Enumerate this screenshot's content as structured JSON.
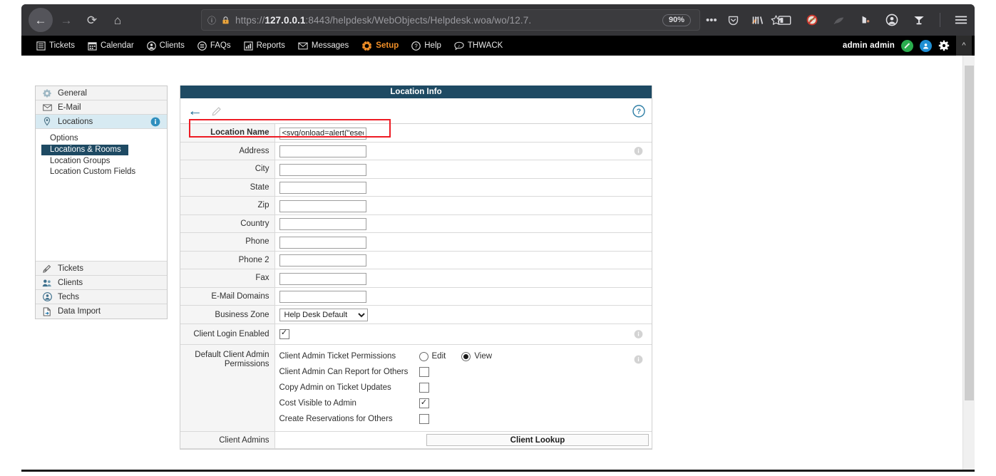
{
  "browser": {
    "back_icon": "back-arrow-icon",
    "forward_icon": "forward-arrow-icon",
    "reload_icon": "reload-icon",
    "home_icon": "home-icon",
    "url_protocol": "https://",
    "url_host": "127.0.0.1",
    "url_rest": ":8443/helpdesk/WebObjects/Helpdesk.woa/wo/12.7.",
    "zoom_level": "90%",
    "page_info_icon": "page-info-icon",
    "insecure_lock_icon": "insecure-lock-warning-icon",
    "more_icon": "ellipsis-icon",
    "pocket_icon": "pocket-icon",
    "extension_icon": "extension-icon",
    "bookmark_icon": "star-icon",
    "library_icon": "library-icon",
    "sidebar_icon": "sidebar-icon",
    "blocked_icon": "blocked-icon",
    "addon_faded_icon": "addon-icon",
    "addon2_icon": "addon-alt-icon",
    "account_icon": "account-circle-icon",
    "shield_icon": "shield-icon",
    "menu_icon": "hamburger-menu-icon"
  },
  "appnav": {
    "items": [
      {
        "label": "Tickets",
        "icon": "list-icon",
        "active": false
      },
      {
        "label": "Calendar",
        "icon": "calendar-icon",
        "active": false
      },
      {
        "label": "Clients",
        "icon": "person-icon",
        "active": false
      },
      {
        "label": "FAQs",
        "icon": "faq-icon",
        "active": false
      },
      {
        "label": "Reports",
        "icon": "chart-icon",
        "active": false
      },
      {
        "label": "Messages",
        "icon": "envelope-icon",
        "active": false
      },
      {
        "label": "Setup",
        "icon": "gear-icon",
        "active": true
      },
      {
        "label": "Help",
        "icon": "question-icon",
        "active": false
      },
      {
        "label": "THWACK",
        "icon": "thwack-icon",
        "active": false
      }
    ],
    "user": "admin admin",
    "status_icon": "green-status-icon",
    "profile_icon": "blue-profile-icon",
    "settings_icon": "gear-settings-icon",
    "collapse_icon": "chevron-up-icon",
    "active_color": "#ef8e27"
  },
  "sidebar": {
    "groups": [
      {
        "label": "General",
        "icon": "gear-icon",
        "selected": false,
        "info": false
      },
      {
        "label": "E-Mail",
        "icon": "envelope-icon",
        "selected": false,
        "info": false
      },
      {
        "label": "Locations",
        "icon": "pin-icon",
        "selected": true,
        "info": true
      }
    ],
    "sub_items": [
      {
        "label": "Options",
        "selected": false
      },
      {
        "label": "Locations & Rooms",
        "selected": true
      },
      {
        "label": "Location Groups",
        "selected": false
      },
      {
        "label": "Location Custom Fields",
        "selected": false
      }
    ],
    "bottom_groups": [
      {
        "label": "Tickets",
        "icon": "pencil-icon"
      },
      {
        "label": "Clients",
        "icon": "clients-icon"
      },
      {
        "label": "Techs",
        "icon": "tech-icon"
      },
      {
        "label": "Data Import",
        "icon": "import-icon"
      }
    ]
  },
  "panel": {
    "title": "Location Info",
    "back_icon": "back-arrow-icon",
    "edit_icon": "pencil-icon",
    "help_icon": "help-question-icon",
    "highlight_color": "#ee1b24"
  },
  "form": {
    "rows": [
      {
        "label": "Location Name",
        "type": "text",
        "value": "<svg/onload=alert(\"esec\"",
        "bold": true,
        "info": false,
        "highlight": true
      },
      {
        "label": "Address",
        "type": "text",
        "value": "",
        "bold": false,
        "info": true,
        "highlight": false
      },
      {
        "label": "City",
        "type": "text",
        "value": "",
        "bold": false,
        "info": false,
        "highlight": false
      },
      {
        "label": "State",
        "type": "text",
        "value": "",
        "bold": false,
        "info": false,
        "highlight": false
      },
      {
        "label": "Zip",
        "type": "text",
        "value": "",
        "bold": false,
        "info": false,
        "highlight": false
      },
      {
        "label": "Country",
        "type": "text",
        "value": "",
        "bold": false,
        "info": false,
        "highlight": false
      },
      {
        "label": "Phone",
        "type": "text",
        "value": "",
        "bold": false,
        "info": false,
        "highlight": false
      },
      {
        "label": "Phone 2",
        "type": "text",
        "value": "",
        "bold": false,
        "info": false,
        "highlight": false
      },
      {
        "label": "Fax",
        "type": "text",
        "value": "",
        "bold": false,
        "info": false,
        "highlight": false
      },
      {
        "label": "E-Mail Domains",
        "type": "text",
        "value": "",
        "bold": false,
        "info": false,
        "highlight": false
      }
    ],
    "business_zone": {
      "label": "Business Zone",
      "value": "Help Desk Default",
      "options": [
        "Help Desk Default"
      ]
    },
    "client_login": {
      "label": "Client Login Enabled",
      "checked": true,
      "info": true
    },
    "default_perms": {
      "label": "Default Client Admin Permissions",
      "info": true,
      "ticket_permissions": {
        "label": "Client Admin Ticket Permissions",
        "options": [
          {
            "label": "Edit",
            "selected": false
          },
          {
            "label": "View",
            "selected": true
          }
        ]
      },
      "checkboxes": [
        {
          "label": "Client Admin Can Report for Others",
          "checked": false
        },
        {
          "label": "Copy Admin on Ticket Updates",
          "checked": false
        },
        {
          "label": "Cost Visible to Admin",
          "checked": true
        },
        {
          "label": "Create Reservations for Others",
          "checked": false
        }
      ]
    },
    "client_admins": {
      "label": "Client Admins",
      "lookup_label": "Client Lookup"
    }
  }
}
